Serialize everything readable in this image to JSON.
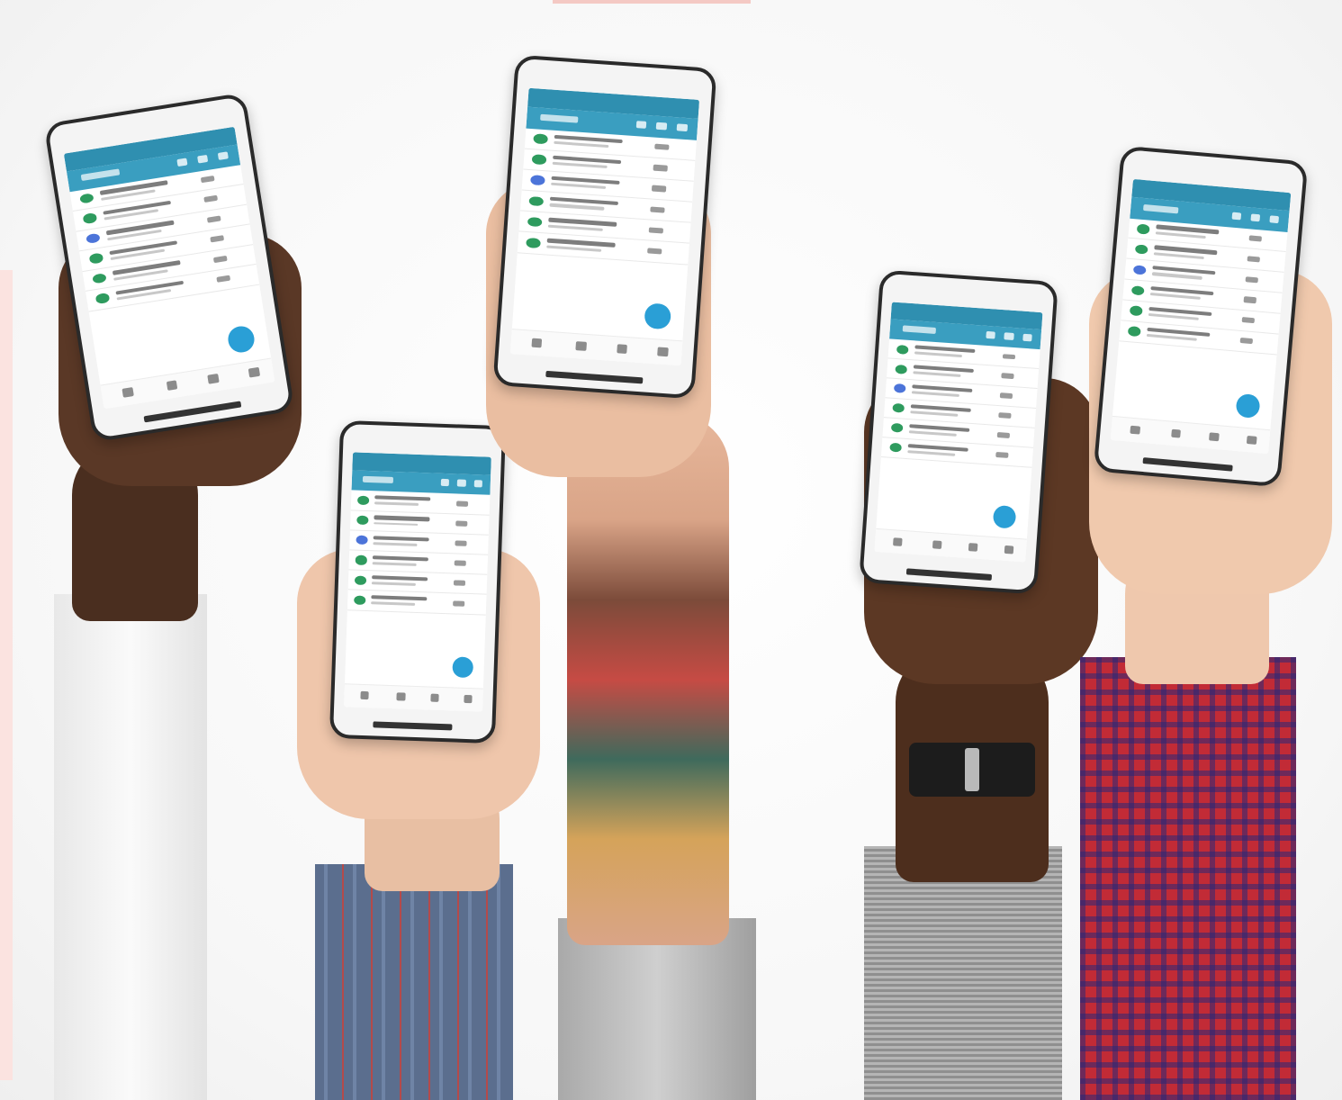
{
  "scene": {
    "description_colors": {
      "background": "#f7f7f7",
      "app_primary": "#3a9ec0",
      "fab": "#2a9fd6"
    }
  },
  "phones": [
    {
      "rows": 6
    },
    {
      "rows": 6
    },
    {
      "rows": 6
    },
    {
      "rows": 6
    },
    {
      "rows": 6
    }
  ]
}
